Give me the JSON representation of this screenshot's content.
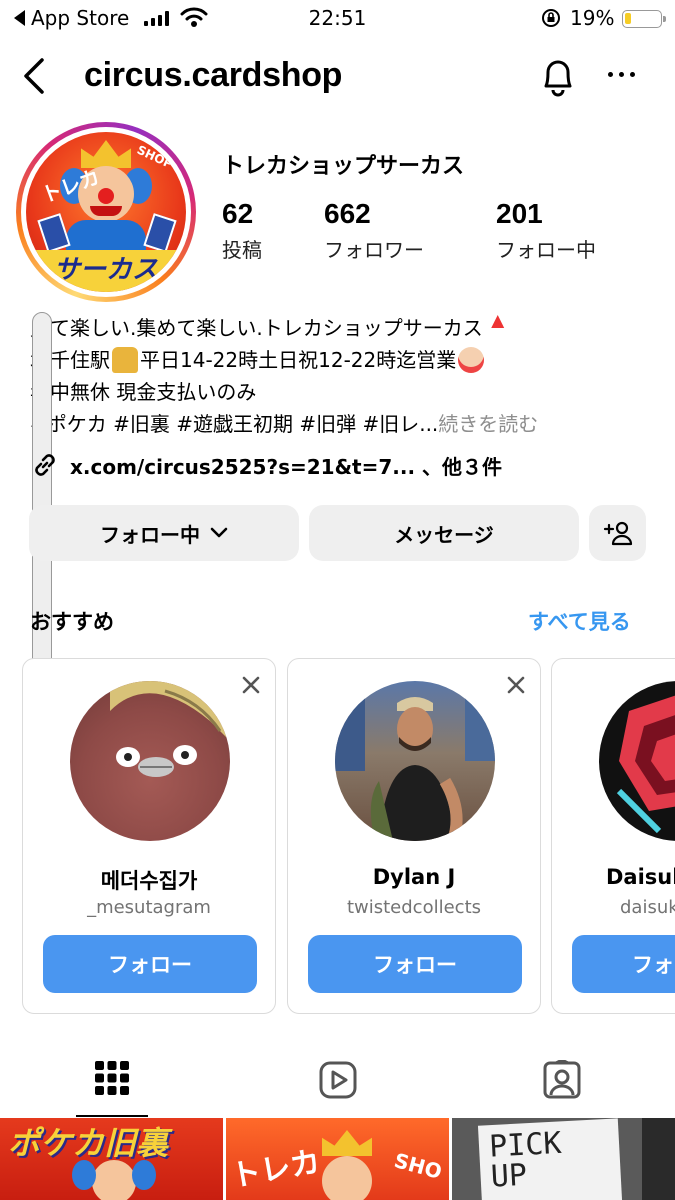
{
  "status_bar": {
    "back_app": "App Store",
    "time": "22:51",
    "battery_pct": "19%",
    "battery_level": 0.19
  },
  "header": {
    "username": "circus.cardshop",
    "icons": [
      "back-chevron-icon",
      "bell-icon",
      "more-icon"
    ]
  },
  "profile": {
    "display_name": "トレカショップサーカス",
    "avatar_text_top": "トレカ",
    "avatar_text_shop": "SHOP",
    "avatar_text_banner": "サーカス",
    "stats": [
      {
        "value": "62",
        "label": "投稿"
      },
      {
        "value": "662",
        "label": "フォロワー"
      },
      {
        "value": "201",
        "label": "フォロー中"
      }
    ],
    "bio": {
      "line1": "見て楽しい.集めて楽しい.トレカショップサーカス",
      "line2a": "北千住駅",
      "line2b": " 平日14-22時土日祝12-22時迄営業",
      "line3": "年中無休 現金支払いのみ",
      "line4": "#ポケカ #旧裏 #遊戯王初期 #旧弾 #旧レ...",
      "more": " 続きを読む"
    },
    "link": "x.com/circus2525?s=21&t=7... 、他３件"
  },
  "actions": {
    "following": "フォロー中",
    "message": "メッセージ"
  },
  "suggestions": {
    "title": "おすすめ",
    "see_all": "すべて見る",
    "cards": [
      {
        "name": "메더수집가",
        "handle": "_mesutagram",
        "button": "フォロー"
      },
      {
        "name": "Dylan J",
        "handle": "twistedcollects",
        "button": "フォロー"
      },
      {
        "name": "Daisuk",
        "handle": "daisuk",
        "button": "フォ"
      }
    ]
  },
  "tabs": [
    "grid-icon",
    "reels-icon",
    "tagged-icon"
  ],
  "grid": {
    "post1_text": "ポケカ旧裏",
    "post2_text": "トレカ",
    "post2_shop": "SHO",
    "post3_text": "PICK UP"
  },
  "colors": {
    "accent": "#3797f0",
    "button_blue": "#4a96f0",
    "button_grey": "#efefef"
  }
}
